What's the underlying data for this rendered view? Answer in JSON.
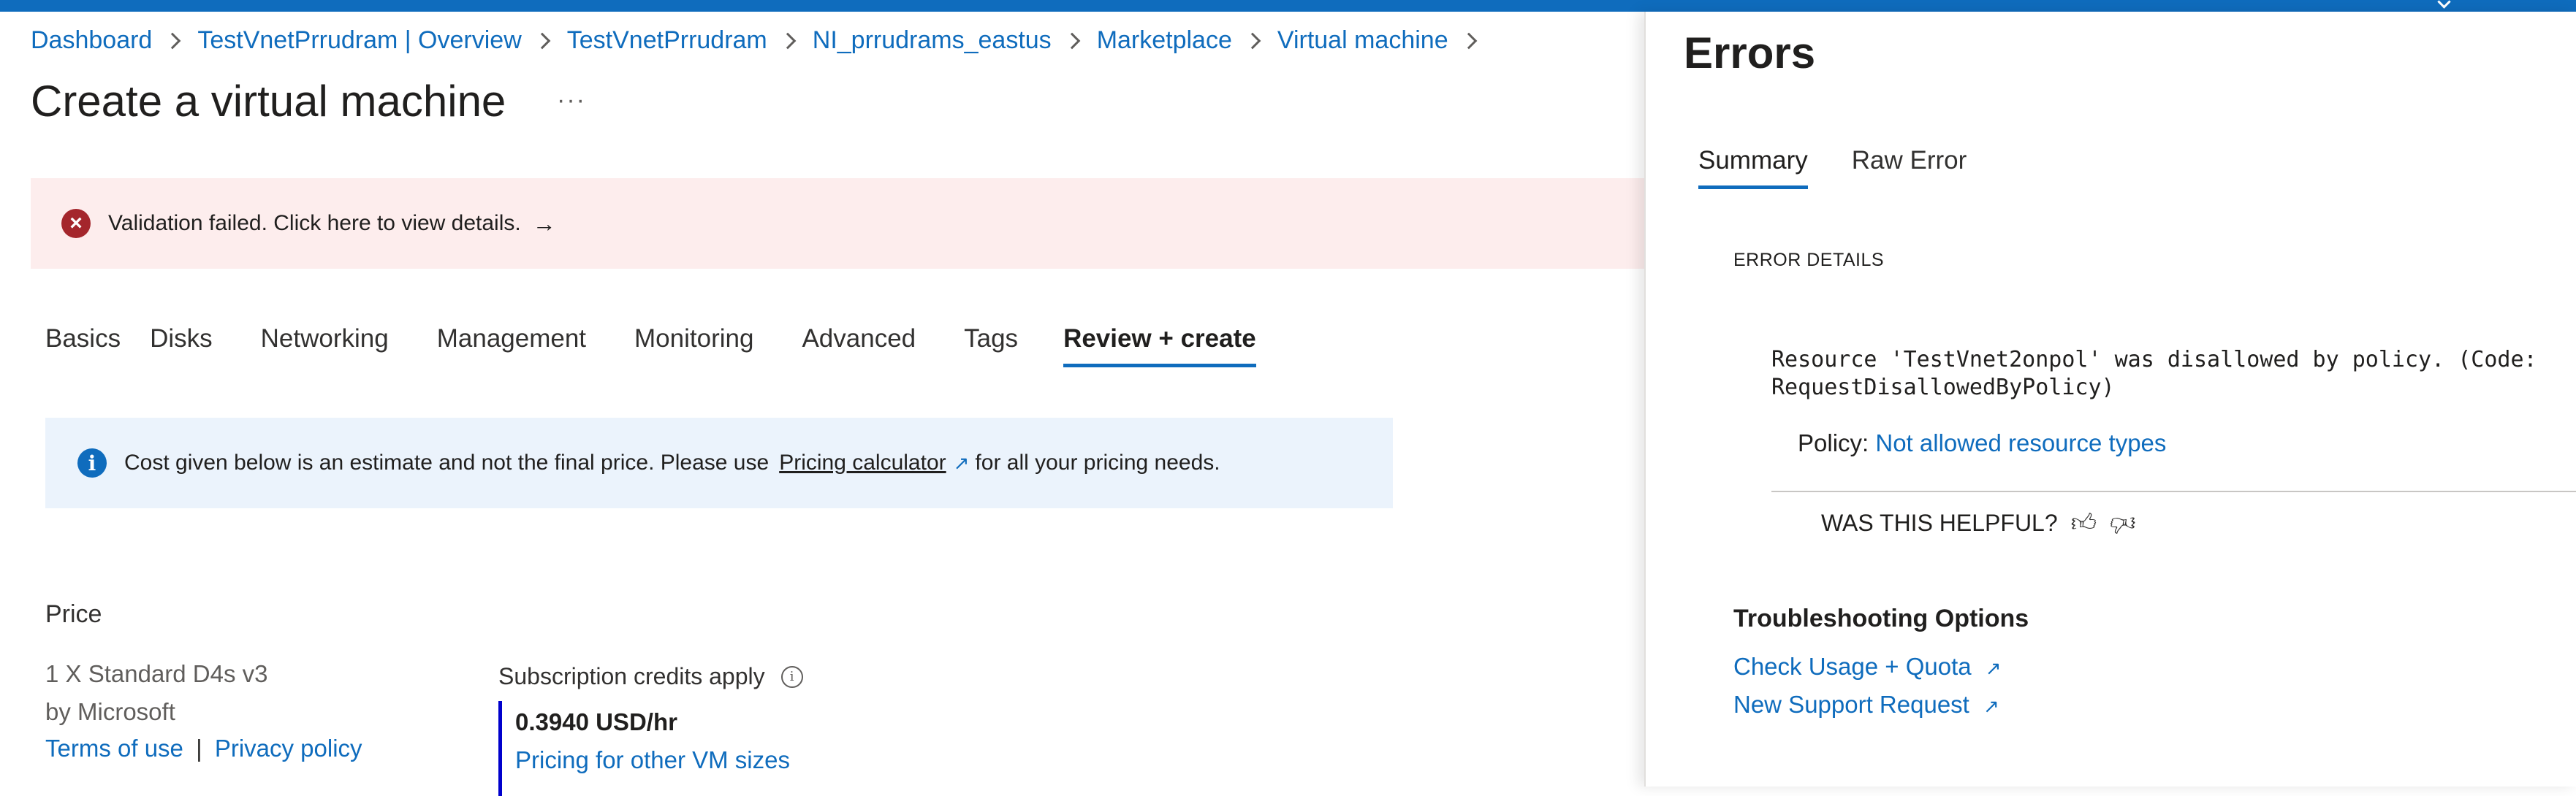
{
  "breadcrumb": {
    "items": [
      "Dashboard",
      "TestVnetPrrudram | Overview",
      "TestVnetPrrudram",
      "NI_prrudrams_eastus",
      "Marketplace",
      "Virtual machine"
    ]
  },
  "page": {
    "title": "Create a virtual machine",
    "more_label": "···"
  },
  "validation_banner": {
    "text": "Validation failed. Click here to view details.",
    "arrow": "→"
  },
  "tabs": {
    "items": [
      "Basics",
      "Disks",
      "Networking",
      "Management",
      "Monitoring",
      "Advanced",
      "Tags",
      "Review + create"
    ],
    "active": "Review + create"
  },
  "info_banner": {
    "prefix": "Cost given below is an estimate and not the final price. Please use",
    "link": "Pricing calculator",
    "suffix": "for all your pricing needs."
  },
  "price": {
    "heading": "Price",
    "vm_size": "1 X Standard D4s v3",
    "publisher": "by Microsoft",
    "terms_link": "Terms of use",
    "separator": "|",
    "privacy_link": "Privacy policy",
    "credits_label": "Subscription credits apply",
    "price_value": "0.3940 USD/hr",
    "other_sizes_link": "Pricing for other VM sizes"
  },
  "errors_panel": {
    "title": "Errors",
    "tabs": [
      "Summary",
      "Raw Error"
    ],
    "active_tab": "Summary",
    "details_heading": "ERROR DETAILS",
    "message": "Resource 'TestVnet2onpol' was disallowed by policy. (Code: RequestDisallowedByPolicy)",
    "policy_label": "Policy:",
    "policy_link": "Not allowed resource types",
    "helpful_label": "WAS THIS HELPFUL?",
    "troubleshooting_heading": "Troubleshooting Options",
    "troubleshooting_links": [
      "Check Usage + Quota",
      "New Support Request"
    ]
  },
  "colors": {
    "accent": "#0f6cbd",
    "error": "#a4262c",
    "error_background": "#fdeded",
    "info_background": "#ebf3fc"
  },
  "icons": [
    "error-circle-icon",
    "arrow-right-icon",
    "info-icon",
    "external-link-icon",
    "thumbs-up-icon",
    "thumbs-down-icon",
    "chevron-right-icon"
  ]
}
